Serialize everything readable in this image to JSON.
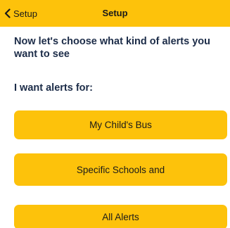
{
  "nav": {
    "back_label": "Setup",
    "title": "Setup"
  },
  "content": {
    "heading": "Now let's choose what kind of alerts you want to see",
    "subheading": "I want alerts for:"
  },
  "options": [
    {
      "label": "My Child's Bus"
    },
    {
      "label": "Specific Schools and"
    },
    {
      "label": "All Alerts"
    }
  ],
  "colors": {
    "accent": "#FDC20B",
    "heading_text": "#1c2c48"
  },
  "icons": {
    "back": "chevron-left-icon"
  }
}
